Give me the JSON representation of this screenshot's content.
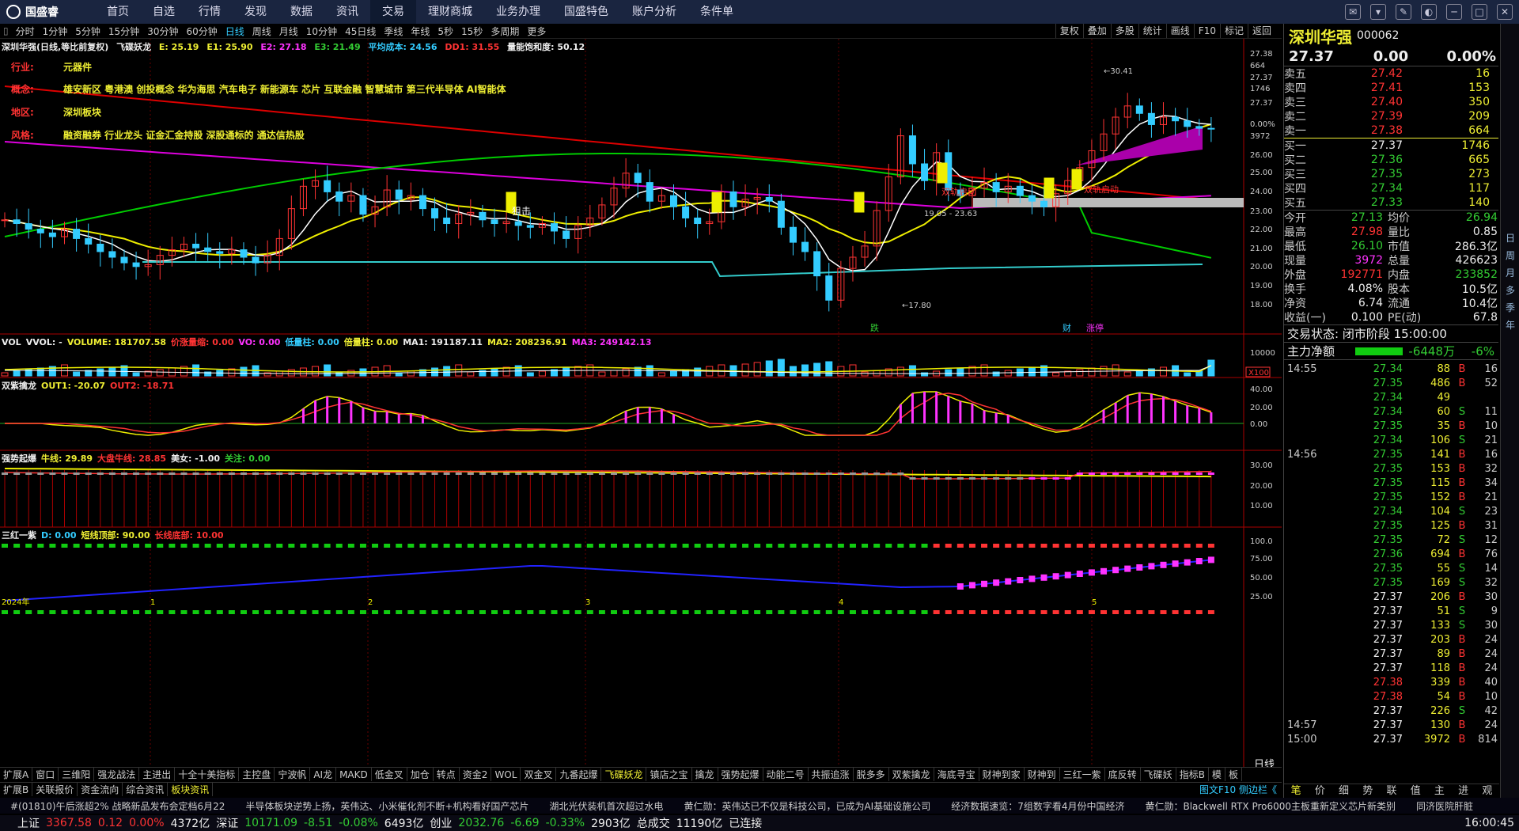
{
  "app": {
    "logo": "国盛睿",
    "nav": [
      "首页",
      "自选",
      "行情",
      "发现",
      "数据",
      "资讯",
      "交易",
      "理财商城",
      "业务办理",
      "国盛特色",
      "账户分析",
      "条件单"
    ],
    "active_nav": "交易"
  },
  "periods": [
    "分时",
    "1分钟",
    "5分钟",
    "15分钟",
    "30分钟",
    "60分钟",
    "日线",
    "周线",
    "月线",
    "10分钟",
    "45日线",
    "季线",
    "年线",
    "5秒",
    "15秒",
    "多周期",
    "更多"
  ],
  "active_period": "日线",
  "tools": [
    "复权",
    "叠加",
    "多股",
    "统计",
    "画线",
    "F10",
    "标记",
    "返回"
  ],
  "main_title": {
    "name": "深圳华强(日线,等比前复权)",
    "indicator": "飞碟妖龙",
    "e1": "E: 25.19",
    "e2": "E1: 25.90",
    "e3": "E2: 27.18",
    "e4": "E3: 21.49",
    "cost": "平均成本: 24.56",
    "dd": "DD1: 31.55",
    "energy": "量能饱和度: 50.12"
  },
  "info": {
    "industry_label": "行业:",
    "industry": "元器件",
    "concept_label": "概念:",
    "concept": "雄安新区 粤港澳 创投概念 华为海思 汽车电子 新能源车 芯片 互联金融 智慧城市 第三代半导体 AI智能体",
    "region_label": "地区:",
    "region": "深圳板块",
    "style_label": "风格:",
    "style": "融资融券 行业龙头 证金汇金持股 深股通标的 通达信热股"
  },
  "chart_labels": {
    "high": "30.41",
    "low": "17.80",
    "range": "19.05 - 23.63",
    "sniper": "狙击",
    "mark1": "跌",
    "mark2": "财",
    "mark3": "涨停",
    "seg": "双轨启动",
    "seg2": "双轨启动"
  },
  "y_axis": [
    "27.38",
    "664",
    "27.37",
    "1746",
    "27.37",
    "0.00%",
    "3972",
    "26.00",
    "25.00",
    "24.00",
    "23.00",
    "22.00",
    "21.00",
    "20.00",
    "19.00",
    "18.00"
  ],
  "vol_title": {
    "name": "VOL",
    "v1": "VVOL: -",
    "v2": "VOLUME: 181707.58",
    "v3": "价涨量缩: 0.00",
    "v4": "VO: 0.00",
    "v5": "低量柱: 0.00",
    "v6": "倍量柱: 0.00",
    "v7": "MA1: 191187.11",
    "v8": "MA2: 208236.91",
    "v9": "MA3: 249142.13"
  },
  "vol_axis": [
    "10000",
    "X100"
  ],
  "p3_title": {
    "name": "双紫擒龙",
    "v1": "OUT1: -20.07",
    "v2": "OUT2: -18.71"
  },
  "p3_axis": [
    "40.00",
    "20.00",
    "0.00"
  ],
  "p4_title": {
    "name": "强势起爆",
    "v1": "牛线: 29.89",
    "v2": "大盘牛线: 28.85",
    "v3": "美女: -1.00",
    "v4": "关注: 0.00"
  },
  "p4_axis": [
    "30.00",
    "20.00",
    "10.00"
  ],
  "p5_title": {
    "name": "三红一紫",
    "v1": "D: 0.00",
    "v2": "短线顶部: 90.00",
    "v3": "长线底部: 10.00"
  },
  "p5_axis": [
    "100.0",
    "75.00",
    "50.00",
    "25.00"
  ],
  "date_labels": [
    "2024年",
    "1",
    "2",
    "3",
    "4",
    "5"
  ],
  "bottom_tabs": [
    "扩展A",
    "窗口",
    "三维阳",
    "强龙战法",
    "主进出",
    "十全十美指标",
    "主控盘",
    "宁波帆",
    "AI龙",
    "MAKD",
    "低金叉",
    "加仓",
    "转点",
    "资金2",
    "WOL",
    "双金叉",
    "九番起爆",
    "飞碟妖龙",
    "镇店之宝",
    "擒龙",
    "强势起爆",
    "动能二号",
    "共振追涨",
    "脱多多",
    "双紫擒龙",
    "海底寻宝",
    "财神到家",
    "财神到",
    "三红一紫",
    "底反转",
    "飞碟妖",
    "指标B",
    "模",
    "板"
  ],
  "bottom_tabs2": [
    "扩展B",
    "关联报价",
    "资金流向",
    "综合资讯",
    "板块资讯"
  ],
  "daily_label": "日线",
  "ticker": [
    "#(01810)午后涨超2% 战略新品发布会定档6月22",
    "半导体板块逆势上扬，英伟达、小米催化剂不断+机构看好国产芯片",
    "湖北光伏装机首次超过水电",
    "黄仁勋：英伟达已不仅是科技公司，已成为AI基础设施公司",
    "经济数据速览：7组数字看4月份中国经济",
    "黄仁勋：Blackwell RTX Pro6000主板重新定义芯片新类别",
    "同济医院肝脏"
  ],
  "status": {
    "sh_label": "上证",
    "sh": "3367.58",
    "sh_chg": "0.12",
    "sh_pct": "0.00%",
    "sh_amt": "4372亿",
    "sz_label": "深证",
    "sz": "10171.09",
    "sz_chg": "-8.51",
    "sz_pct": "-0.08%",
    "sz_amt": "6493亿",
    "cy_label": "创业",
    "cy": "2032.76",
    "cy_chg": "-6.69",
    "cy_pct": "-0.33%",
    "cy_amt": "2903亿",
    "total_label": "总成交",
    "total": "11190亿",
    "conn": "已连接",
    "time": "16:00:45"
  },
  "quote": {
    "name": "深圳华强",
    "code": "000062",
    "price": "27.37",
    "chg": "0.00",
    "pct": "0.00%",
    "asks": [
      {
        "l": "卖五",
        "p": "27.42",
        "v": "16"
      },
      {
        "l": "卖四",
        "p": "27.41",
        "v": "153"
      },
      {
        "l": "卖三",
        "p": "27.40",
        "v": "350"
      },
      {
        "l": "卖二",
        "p": "27.39",
        "v": "209"
      },
      {
        "l": "卖一",
        "p": "27.38",
        "v": "664"
      }
    ],
    "bids": [
      {
        "l": "买一",
        "p": "27.37",
        "v": "1746"
      },
      {
        "l": "买二",
        "p": "27.36",
        "v": "665"
      },
      {
        "l": "买三",
        "p": "27.35",
        "v": "273"
      },
      {
        "l": "买四",
        "p": "27.34",
        "v": "117"
      },
      {
        "l": "买五",
        "p": "27.33",
        "v": "140"
      }
    ],
    "stats": [
      [
        "今开",
        "27.13",
        "均价",
        "26.94"
      ],
      [
        "最高",
        "27.98",
        "量比",
        "0.85"
      ],
      [
        "最低",
        "26.10",
        "市值",
        "286.3亿"
      ],
      [
        "现量",
        "3972",
        "总量",
        "426623"
      ],
      [
        "外盘",
        "192771",
        "内盘",
        "233852"
      ],
      [
        "换手",
        "4.08%",
        "股本",
        "10.5亿"
      ],
      [
        "净资",
        "6.74",
        "流通",
        "10.4亿"
      ],
      [
        "收益(一)",
        "0.100",
        "PE(动)",
        "67.8"
      ]
    ],
    "state": "交易状态: 闭市阶段 15:00:00",
    "main_label": "主力净额",
    "main_val": "-6448万",
    "main_pct": "-6%"
  },
  "ticks": [
    [
      "14:55",
      "27.34",
      "88",
      "B",
      "16"
    ],
    [
      "",
      "27.35",
      "486",
      "B",
      "52"
    ],
    [
      "",
      "27.34",
      "49",
      "",
      ""
    ],
    [
      "",
      "27.34",
      "60",
      "S",
      "11"
    ],
    [
      "",
      "27.35",
      "35",
      "B",
      "10"
    ],
    [
      "",
      "27.34",
      "106",
      "S",
      "21"
    ],
    [
      "14:56",
      "27.35",
      "141",
      "B",
      "16"
    ],
    [
      "",
      "27.35",
      "153",
      "B",
      "32"
    ],
    [
      "",
      "27.35",
      "115",
      "B",
      "34"
    ],
    [
      "",
      "27.35",
      "152",
      "B",
      "21"
    ],
    [
      "",
      "27.34",
      "104",
      "S",
      "23"
    ],
    [
      "",
      "27.35",
      "125",
      "B",
      "31"
    ],
    [
      "",
      "27.35",
      "72",
      "S",
      "12"
    ],
    [
      "",
      "27.36",
      "694",
      "B",
      "76"
    ],
    [
      "",
      "27.35",
      "55",
      "S",
      "14"
    ],
    [
      "",
      "27.35",
      "169",
      "S",
      "32"
    ],
    [
      "",
      "27.37",
      "206",
      "B",
      "30"
    ],
    [
      "",
      "27.37",
      "51",
      "S",
      "9"
    ],
    [
      "",
      "27.37",
      "133",
      "S",
      "30"
    ],
    [
      "",
      "27.37",
      "203",
      "B",
      "24"
    ],
    [
      "",
      "27.37",
      "89",
      "B",
      "24"
    ],
    [
      "",
      "27.37",
      "118",
      "B",
      "24"
    ],
    [
      "",
      "27.38",
      "339",
      "B",
      "40"
    ],
    [
      "",
      "27.38",
      "54",
      "B",
      "10"
    ],
    [
      "",
      "27.37",
      "226",
      "S",
      "42"
    ],
    [
      "14:57",
      "27.37",
      "130",
      "B",
      "24"
    ],
    [
      "15:00",
      "27.37",
      "3972",
      "B",
      "814"
    ]
  ],
  "bottom_right_tabs": [
    "笔",
    "价",
    "细",
    "势",
    "联",
    "值",
    "主",
    "进",
    "观"
  ],
  "rside": [
    "日",
    "周",
    "月",
    "多",
    "季",
    "年"
  ],
  "f10": "图文F10 侧边栏《"
}
